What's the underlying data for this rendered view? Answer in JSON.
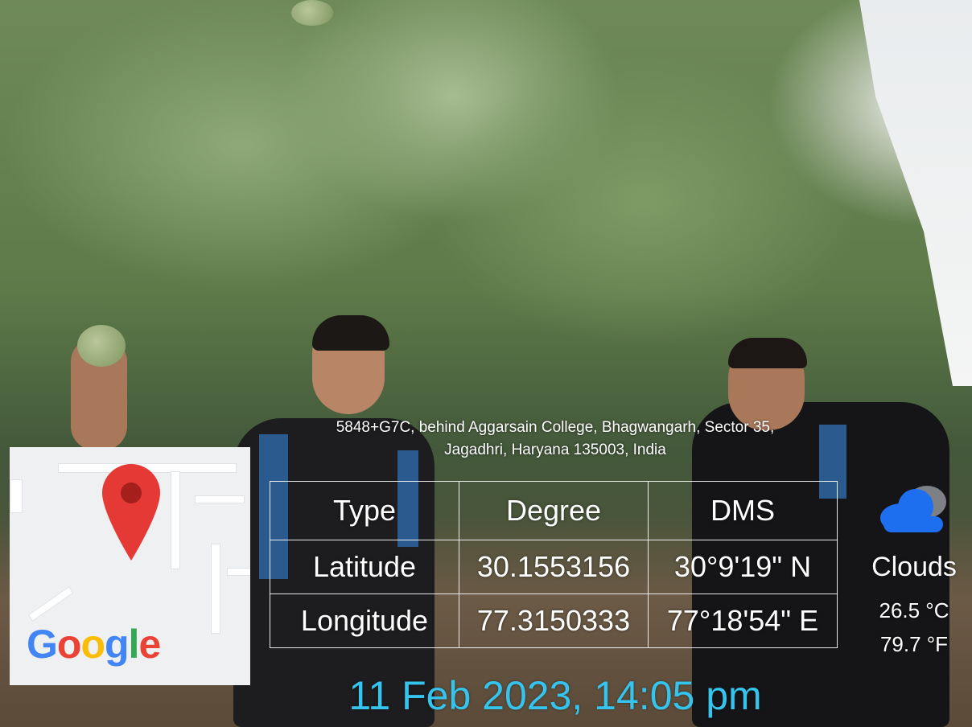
{
  "address": {
    "line1": "5848+G7C, behind Aggarsain College, Bhagwangarh, Sector 35,",
    "line2": "Jagadhri, Haryana 135003, India"
  },
  "map": {
    "logo_text": "Google",
    "pin_icon": "map-pin-icon",
    "pin_color": "#e53935"
  },
  "coordinates_table": {
    "headers": [
      "Type",
      "Degree",
      "DMS"
    ],
    "rows": [
      [
        "Latitude",
        "30.1553156",
        "30°9'19\" N"
      ],
      [
        "Longitude",
        "77.3150333",
        "77°18'54\" E"
      ]
    ]
  },
  "weather": {
    "icon": "cloud-icon",
    "condition": "Clouds",
    "temp_c": "26.5 °C",
    "temp_f": "79.7 °F"
  },
  "timestamp": "11 Feb 2023, 14:05 pm",
  "colors": {
    "timestamp": "#34c4ee",
    "cloud": "#1e6ff0"
  }
}
